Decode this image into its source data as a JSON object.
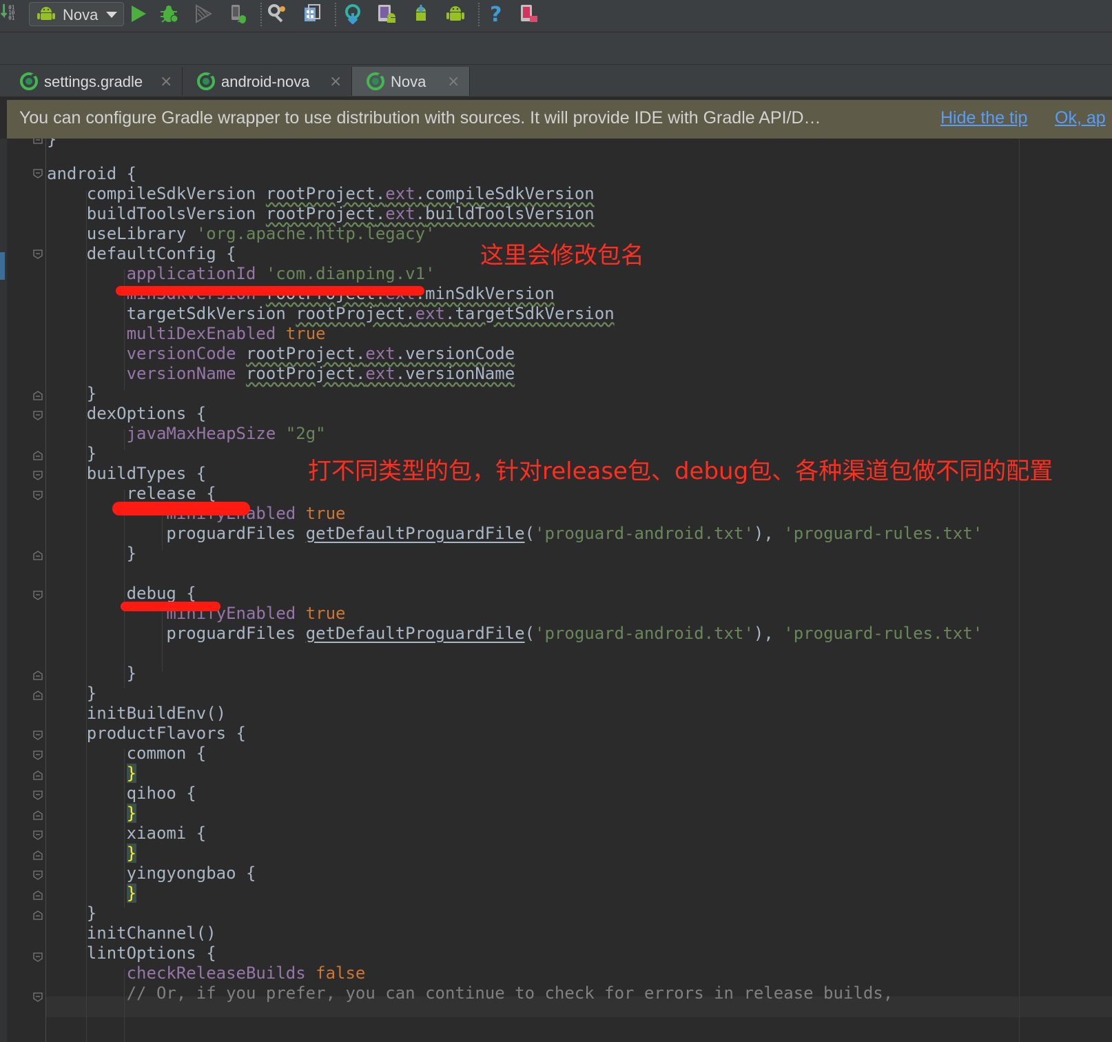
{
  "toolbar": {
    "run_config_label": "Nova",
    "icons": [
      "make-project-icon",
      "android-run-config-icon",
      "run-icon",
      "debug-icon",
      "coverage-icon",
      "attach-debugger-icon",
      "project-structure-icon",
      "sdk-manager-icon",
      "sync-gradle-icon",
      "avd-manager-icon",
      "android-sdk-download-icon",
      "android-icon",
      "help-icon",
      "device-monitor-icon"
    ]
  },
  "tabs": [
    {
      "label": "settings.gradle",
      "active": false
    },
    {
      "label": "android-nova",
      "active": false
    },
    {
      "label": "Nova",
      "active": true
    }
  ],
  "tab_close_glyph": "×",
  "tip": {
    "text": "You can configure Gradle wrapper to use distribution with sources. It will provide IDE with Gradle API/D…",
    "hide_link": "Hide the tip",
    "ok_link": "Ok, ap"
  },
  "code": {
    "l0": "}",
    "l1": "android {",
    "l2a": "    compileSdkVersion ",
    "l2b": "rootProject",
    "l2c": ".",
    "l2d": "ext",
    "l2e": ".",
    "l2f": "compileSdkVersion",
    "l3a": "    buildToolsVersion ",
    "l3b": "rootProject",
    "l3c": ".",
    "l3d": "ext",
    "l3e": ".",
    "l3f": "buildToolsVersion",
    "l4a": "    useLibrary ",
    "l4b": "'org.apache.http.legacy'",
    "l5": "    defaultConfig {",
    "l6a": "        applicationId",
    "l6b": " 'com.dianping.v1'",
    "l7a": "        minSdkVersion ",
    "l7b": "rootProject",
    "l7c": ".",
    "l7d": "ext",
    "l7e": ".",
    "l7f": "minSdkVersion",
    "l8a": "        targetSdkVersion ",
    "l8b": "rootProject",
    "l8c": ".",
    "l8d": "ext",
    "l8e": ".",
    "l8f": "targetSdkVersion",
    "l9a": "        multiDexEnabled",
    "l9b": " true",
    "l10a": "        versionCode ",
    "l10b": "rootProject",
    "l10c": ".",
    "l10d": "ext",
    "l10e": ".",
    "l10f": "versionCode",
    "l11a": "        versionName ",
    "l11b": "rootProject",
    "l11c": ".",
    "l11d": "ext",
    "l11e": ".",
    "l11f": "versionName",
    "l12": "    }",
    "l13": "    dexOptions {",
    "l14a": "        javaMaxHeapSize",
    "l14b": " \"2g\"",
    "l15": "    }",
    "l16": "    buildTypes {",
    "l17": "        release {",
    "l18a": "            minifyEnabled",
    "l18b": " true",
    "l19a": "            proguardFiles ",
    "l19b": "getDefaultProguardFile",
    "l19c": "(",
    "l19d": "'proguard-android.txt'",
    "l19e": "), ",
    "l19f": "'proguard-rules.txt'",
    "l20": "        }",
    "l22": "        debug {",
    "l23a": "            minifyEnabled",
    "l23b": " true",
    "l24a": "            proguardFiles ",
    "l24b": "getDefaultProguardFile",
    "l24c": "(",
    "l24d": "'proguard-android.txt'",
    "l24e": "), ",
    "l24f": "'proguard-rules.txt'",
    "l26": "        }",
    "l27": "    }",
    "l28": "    initBuildEnv()",
    "l29": "    productFlavors {",
    "l30": "        common {",
    "l31a": "        ",
    "l31b": "}",
    "l32": "        qihoo {",
    "l33a": "        ",
    "l33b": "}",
    "l34": "        xiaomi {",
    "l35a": "        ",
    "l35b": "}",
    "l36": "        yingyongbao {",
    "l37a": "        ",
    "l37b": "}",
    "l38": "    }",
    "l39": "    initChannel()",
    "l40": "    lintOptions {",
    "l41a": "        checkReleaseBuilds",
    "l41b": " false",
    "l42": "        // Or, if you prefer, you can continue to check for errors in release builds,"
  },
  "annotations": {
    "package_name": "这里会修改包名",
    "build_types": "打不同类型的包，针对release包、debug包、各种渠道包做不同的配置"
  },
  "colors": {
    "editor_bg": "#2b2b2b",
    "keyword": "#cc7832",
    "string": "#6a8759",
    "property": "#9876aa",
    "annotation_red": "#ff2e1f",
    "link": "#589df6"
  }
}
